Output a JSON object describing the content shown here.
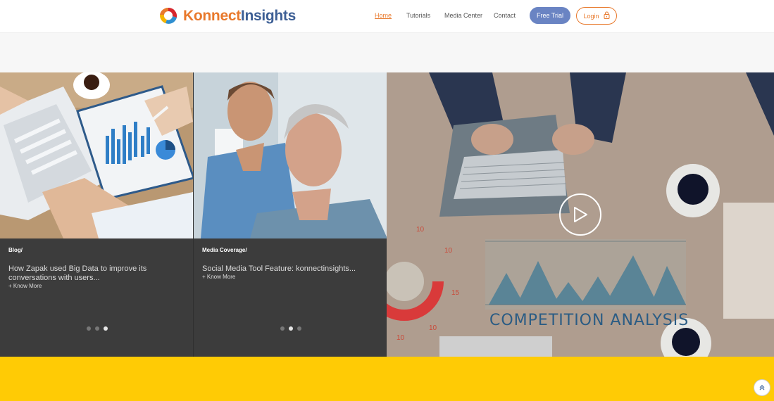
{
  "header": {
    "brand_part1": "Konnect",
    "brand_part2": "Insights",
    "nav": [
      "Home",
      "Tutorials",
      "Media Center",
      "Contact"
    ],
    "active_nav": "Home",
    "trial_label": "Free Trial",
    "login_label": "Login"
  },
  "cards": [
    {
      "category": "Blog/",
      "title": "How Zapak used Big Data to improve its conversations with users...",
      "more": "+ Know More",
      "dots": 3,
      "active_dot": 3
    },
    {
      "category": "Media Coverage/",
      "title": "Social Media Tool Feature: konnectinsights...",
      "more": "+ Know More",
      "dots": 3,
      "active_dot": 2
    }
  ],
  "video": {
    "caption": "COMPETITION ANALYSIS",
    "numbers": [
      "10",
      "10",
      "15",
      "10",
      "10"
    ]
  },
  "colors": {
    "brand_orange": "#e8792c",
    "brand_blue": "#3d5f95",
    "trial_blue": "#6a84c3",
    "card_bg": "#3c3c3c",
    "yellow_band": "#ffcb05"
  },
  "icons": [
    "logo-mark-icon",
    "lock-icon",
    "play-icon",
    "chevron-up-icon"
  ]
}
